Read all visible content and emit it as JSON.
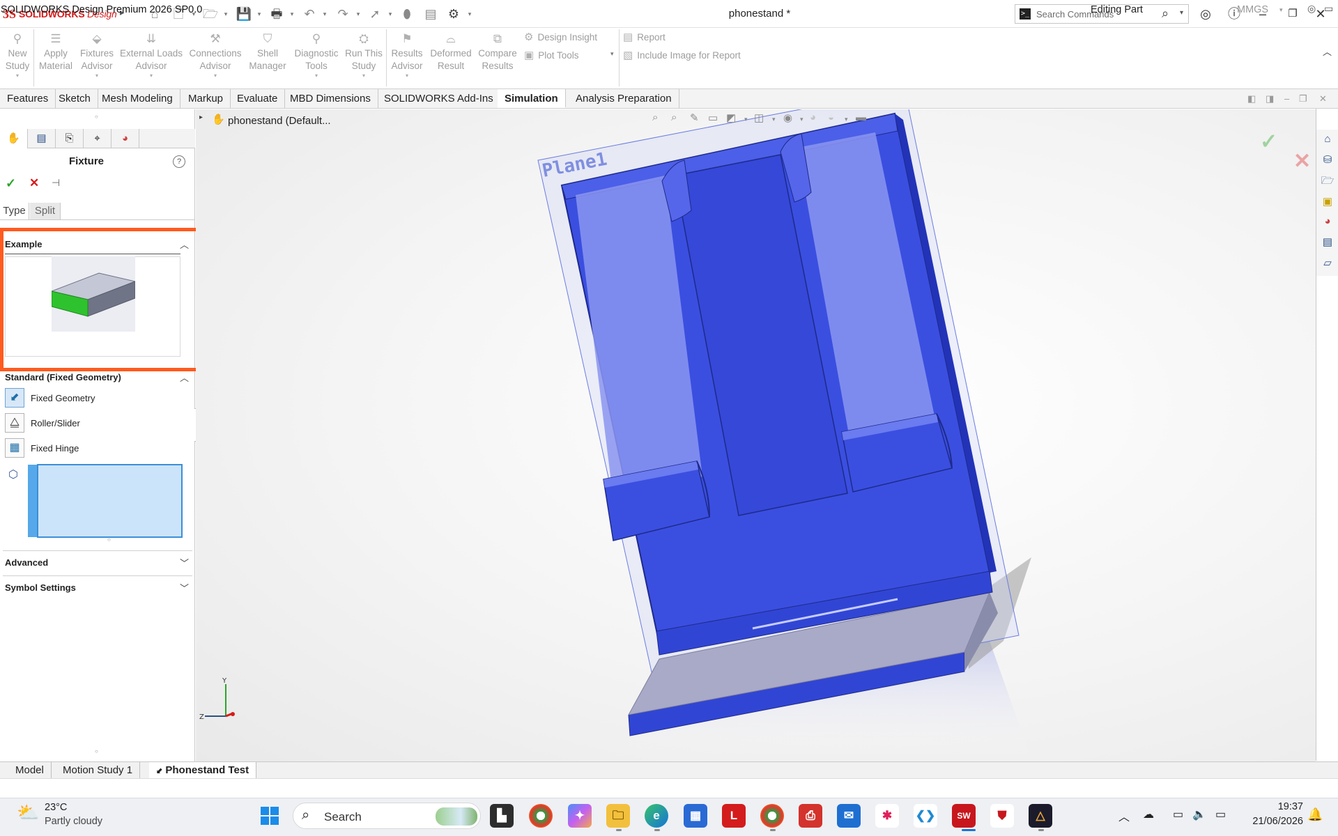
{
  "app": {
    "brand_mark": "3S",
    "brand_name": "SOLIDWORKS",
    "brand_suffix": "Design",
    "menu_arrow": "▸",
    "document_title": "phonestand *"
  },
  "search": {
    "placeholder": "Search Commands"
  },
  "ribbon": {
    "buttons": [
      {
        "l1": "New",
        "l2": "Study",
        "icon": "new-study-icon",
        "dd": true
      },
      {
        "l1": "Apply",
        "l2": "Material",
        "icon": "apply-material-icon",
        "dd": false
      },
      {
        "l1": "Fixtures",
        "l2": "Advisor",
        "icon": "fixtures-advisor-icon",
        "dd": true
      },
      {
        "l1": "External Loads",
        "l2": "Advisor",
        "icon": "external-loads-icon",
        "dd": true
      },
      {
        "l1": "Connections",
        "l2": "Advisor",
        "icon": "connections-advisor-icon",
        "dd": true
      },
      {
        "l1": "Shell",
        "l2": "Manager",
        "icon": "shell-manager-icon",
        "dd": false
      },
      {
        "l1": "Diagnostic",
        "l2": "Tools",
        "icon": "diagnostic-tools-icon",
        "dd": true
      },
      {
        "l1": "Run This",
        "l2": "Study",
        "icon": "run-study-icon",
        "dd": true
      },
      {
        "l1": "Results",
        "l2": "Advisor",
        "icon": "results-advisor-icon",
        "dd": true
      },
      {
        "l1": "Deformed",
        "l2": "Result",
        "icon": "deformed-result-icon",
        "dd": false
      },
      {
        "l1": "Compare",
        "l2": "Results",
        "icon": "compare-results-icon",
        "dd": false
      }
    ],
    "design_insight": "Design Insight",
    "plot_tools": "Plot Tools",
    "report": "Report",
    "include_image": "Include Image for Report"
  },
  "tabs": [
    "Features",
    "Sketch",
    "Mesh Modeling",
    "Markup",
    "Evaluate",
    "MBD Dimensions",
    "SOLIDWORKS Add-Ins",
    "Simulation",
    "Analysis Preparation"
  ],
  "active_tab": "Simulation",
  "feature_tree": {
    "root": "phonestand (Default..."
  },
  "property_manager": {
    "title": "Fixture",
    "help": "?",
    "subtabs": [
      "Type",
      "Split"
    ],
    "example_header": "Example",
    "standard_header": "Standard (Fixed Geometry)",
    "fixtures": [
      {
        "label": "Fixed Geometry",
        "icon": "fixed-geometry-icon",
        "selected": true
      },
      {
        "label": "Roller/Slider",
        "icon": "roller-slider-icon",
        "selected": false
      },
      {
        "label": "Fixed Hinge",
        "icon": "fixed-hinge-icon",
        "selected": false
      }
    ],
    "advanced_header": "Advanced",
    "symbol_header": "Symbol Settings"
  },
  "viewport": {
    "plane_label": "Plane1",
    "model_color": "#3a4fe0",
    "highlight_color": "#ff5a1f"
  },
  "bottom_tabs": [
    "Model",
    "Motion Study 1",
    "Phonestand Test"
  ],
  "active_bottom_tab": "Phonestand Test",
  "status": {
    "product": "SOLIDWORKS Design Premium 2026 SP0.0",
    "mode": "Editing Part",
    "units": "MMGS"
  },
  "taskbar": {
    "temperature": "23°C",
    "weather": "Partly cloudy",
    "search_label": "Search",
    "time": "19:37",
    "date": "21/06/2026",
    "apps": [
      "chrome-icon",
      "copilot-icon",
      "file-explorer-icon",
      "edge-icon",
      "store-icon",
      "l-app-icon",
      "chrome-profile-icon",
      "pdf-icon",
      "outlook-icon",
      "slack-icon",
      "vscode-icon",
      "solidworks-icon",
      "mcafee-icon",
      "affinity-icon"
    ]
  }
}
